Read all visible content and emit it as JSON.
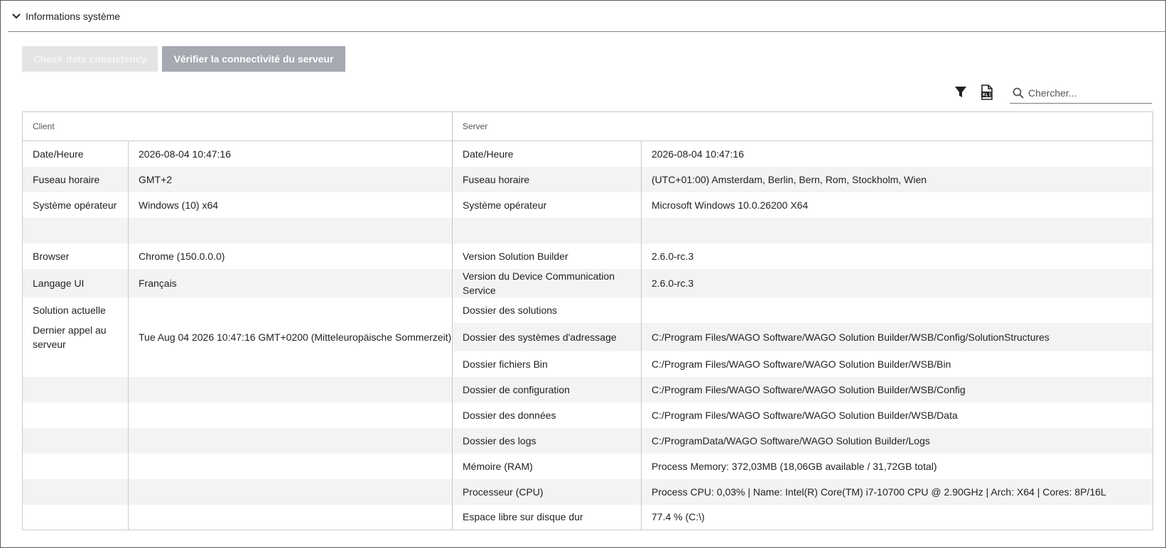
{
  "section": {
    "title": "Informations système"
  },
  "buttons": {
    "check_consistency": "Check data consistency",
    "verify_connectivity": "Vérifier la connectivité du serveur"
  },
  "toolbar": {
    "search_placeholder": "Chercher..."
  },
  "table": {
    "headers": {
      "client": "Client",
      "server": "Server"
    },
    "rows": [
      {
        "client_label": "Date/Heure",
        "client_value": "2026-08-04 10:47:16",
        "server_label": "Date/Heure",
        "server_value": "2026-08-04 10:47:16"
      },
      {
        "client_label": "Fuseau horaire",
        "client_value": "GMT+2",
        "server_label": "Fuseau horaire",
        "server_value": "(UTC+01:00) Amsterdam, Berlin, Bern, Rom, Stockholm, Wien"
      },
      {
        "client_label": "Système opérateur",
        "client_value": "Windows (10) x64",
        "server_label": "Système opérateur",
        "server_value": "Microsoft Windows 10.0.26200 X64"
      },
      {
        "client_label": "",
        "client_value": "",
        "server_label": "",
        "server_value": ""
      },
      {
        "client_label": "Browser",
        "client_value": "Chrome (150.0.0.0)",
        "server_label": "Version Solution Builder",
        "server_value": "2.6.0-rc.3"
      },
      {
        "client_label": "Langage UI",
        "client_value": "Français",
        "server_label": "Version du Device Communication Service",
        "server_value": "2.6.0-rc.3"
      },
      {
        "client_label": "Solution actuelle",
        "client_value": "",
        "server_label": "Dossier des solutions",
        "server_value": ""
      },
      {
        "client_label": "Dernier appel au serveur",
        "client_value": "Tue Aug 04 2026 10:47:16 GMT+0200 (Mitteleuropäische Sommerzeit)",
        "server_label": "Dossier des systèmes d'adressage",
        "server_value": "C:/Program Files/WAGO Software/WAGO Solution Builder/WSB/Config/SolutionStructures"
      },
      {
        "client_label": "",
        "client_value": "",
        "server_label": "Dossier fichiers Bin",
        "server_value": "C:/Program Files/WAGO Software/WAGO Solution Builder/WSB/Bin"
      },
      {
        "client_label": "",
        "client_value": "",
        "server_label": "Dossier de configuration",
        "server_value": "C:/Program Files/WAGO Software/WAGO Solution Builder/WSB/Config"
      },
      {
        "client_label": "",
        "client_value": "",
        "server_label": "Dossier des données",
        "server_value": "C:/Program Files/WAGO Software/WAGO Solution Builder/WSB/Data"
      },
      {
        "client_label": "",
        "client_value": "",
        "server_label": "Dossier des logs",
        "server_value": "C:/ProgramData/WAGO Software/WAGO Solution Builder/Logs"
      },
      {
        "client_label": "",
        "client_value": "",
        "server_label": "Mémoire (RAM)",
        "server_value": "Process Memory: 372,03MB (18,06GB available / 31,72GB total)"
      },
      {
        "client_label": "",
        "client_value": "",
        "server_label": "Processeur (CPU)",
        "server_value": "Process CPU: 0,03% | Name: Intel(R) Core(TM) i7-10700 CPU @ 2.90GHz | Arch: X64 | Cores: 8P/16L"
      },
      {
        "client_label": "",
        "client_value": "",
        "server_label": "Espace libre sur disque dur",
        "server_value": "77.4 % (C:\\)"
      }
    ]
  },
  "icons": {
    "collapse": "chevron-down-icon",
    "filter": "filter-icon",
    "export": "export-xls-icon",
    "search": "search-icon"
  }
}
